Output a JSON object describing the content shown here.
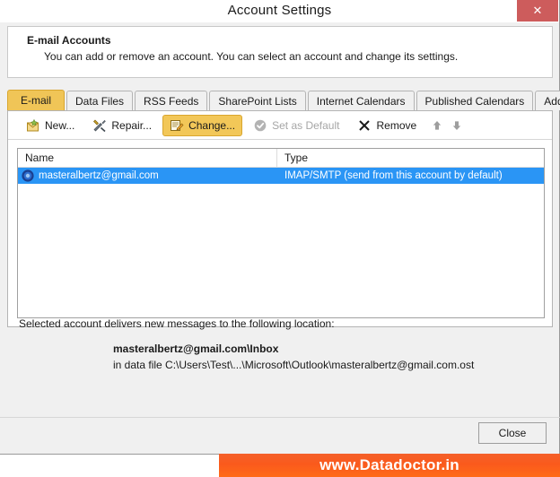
{
  "window": {
    "title": "Account Settings",
    "close_label": "✕"
  },
  "header": {
    "title": "E-mail Accounts",
    "subtitle": "You can add or remove an account. You can select an account and change its settings."
  },
  "tabs": [
    {
      "label": "E-mail",
      "active": true
    },
    {
      "label": "Data Files",
      "active": false
    },
    {
      "label": "RSS Feeds",
      "active": false
    },
    {
      "label": "SharePoint Lists",
      "active": false
    },
    {
      "label": "Internet Calendars",
      "active": false
    },
    {
      "label": "Published Calendars",
      "active": false
    },
    {
      "label": "Address Books",
      "active": false
    }
  ],
  "toolbar": {
    "new_label": "New...",
    "repair_label": "Repair...",
    "change_label": "Change...",
    "set_default_label": "Set as Default",
    "remove_label": "Remove",
    "move_up_label": "",
    "move_down_label": ""
  },
  "list": {
    "columns": [
      "Name",
      "Type"
    ],
    "rows": [
      {
        "name": "masteralbertz@gmail.com",
        "type": "IMAP/SMTP (send from this account by default)",
        "selected": true
      }
    ]
  },
  "details": {
    "intro": "Selected account delivers new messages to the following location:",
    "inbox": "masteralbertz@gmail.com\\Inbox",
    "datafile": "in data file C:\\Users\\Test\\...\\Microsoft\\Outlook\\masteralbertz@gmail.com.ost"
  },
  "footer": {
    "close_label": "Close"
  },
  "banner": {
    "text": "www.Datadoctor.in"
  },
  "colors": {
    "accent_gold": "#f0c557",
    "selection_blue": "#2a95f5",
    "close_red": "#cd5c5c",
    "banner_orange": "#fa5a1c"
  }
}
